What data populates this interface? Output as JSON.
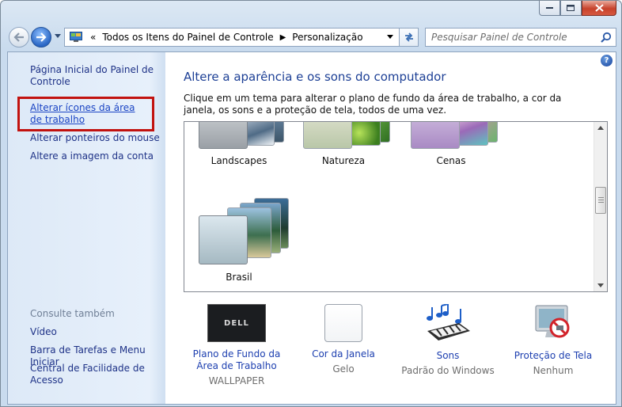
{
  "window": {
    "controls": [
      "minimize-icon",
      "maximize-icon",
      "close-icon"
    ]
  },
  "address_bar": {
    "overflow": "«",
    "crumbs": [
      "Todos os Itens do Painel de Controle",
      "Personalização"
    ],
    "separator": "▶"
  },
  "search": {
    "placeholder": "Pesquisar Painel de Controle"
  },
  "sidebar": {
    "home_label": "Página Inicial do Painel de Controle",
    "links": [
      "Alterar ícones da área de trabalho",
      "Alterar ponteiros do mouse",
      "Altere a imagem da conta"
    ],
    "see_also_heading": "Consulte também",
    "see_also": [
      "Vídeo",
      "Barra de Tarefas e Menu Iniciar",
      "Central de Facilidade de Acesso"
    ]
  },
  "main": {
    "title": "Altere a aparência e os sons do computador",
    "description": "Clique em um tema para alterar o plano de fundo da área de trabalho, a cor da janela, os sons e a proteção de tela, todos de uma vez.",
    "help_symbol": "?"
  },
  "themes": [
    {
      "name": "Landscapes"
    },
    {
      "name": "Natureza"
    },
    {
      "name": "Cenas"
    },
    {
      "name": "Brasil"
    }
  ],
  "settings": [
    {
      "title": "Plano de Fundo da Área de Trabalho",
      "value": "WALLPAPER",
      "icon": "wallpaper-icon",
      "icon_text": "DELL"
    },
    {
      "title": "Cor da Janela",
      "value": "Gelo",
      "icon": "window-color-icon"
    },
    {
      "title": "Sons",
      "value": "Padrão do Windows",
      "icon": "sounds-icon"
    },
    {
      "title": "Proteção de Tela",
      "value": "Nenhum",
      "icon": "screensaver-icon"
    }
  ],
  "colors": {
    "link": "#1e3287",
    "title": "#1c3f95",
    "highlight": "#c2120f"
  }
}
